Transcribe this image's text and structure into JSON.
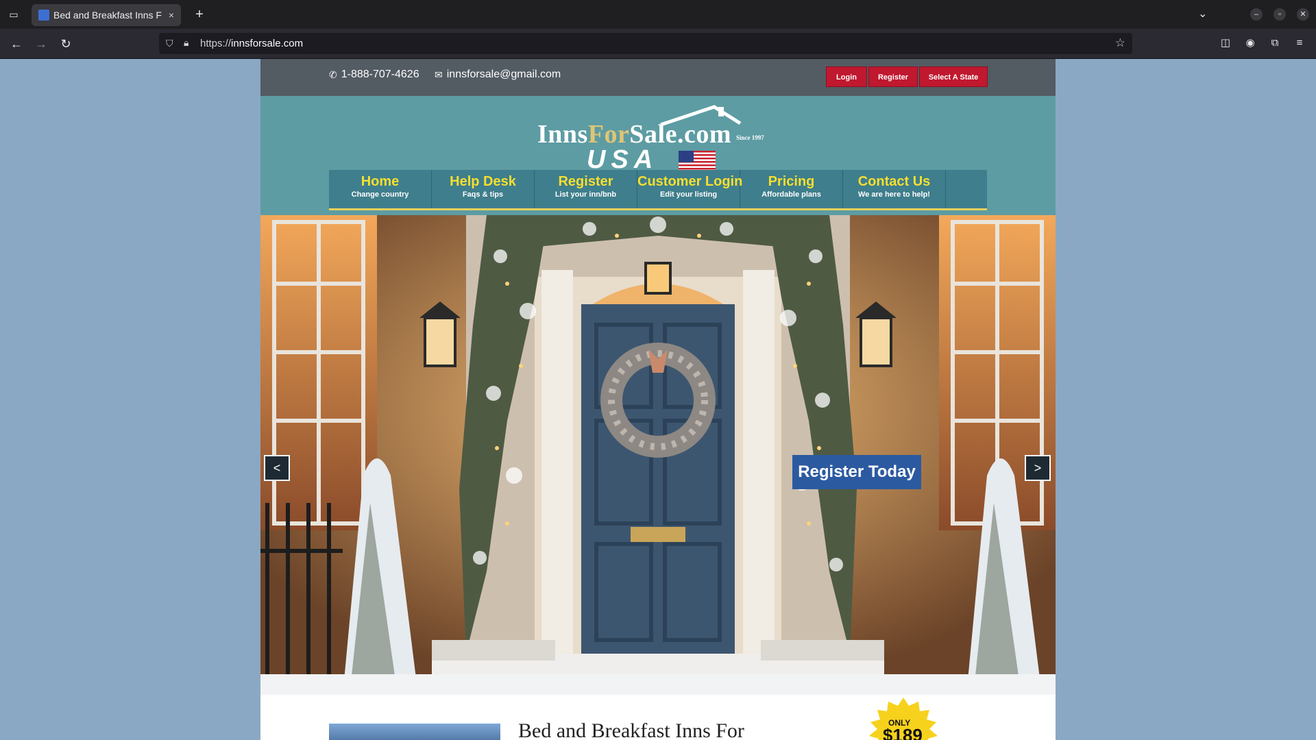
{
  "browser": {
    "tab_title": "Bed and Breakfast Inns F",
    "tab_close": "×",
    "new_tab": "+",
    "url_prefix": "https://",
    "url_host": "innsforsale.com"
  },
  "topbar": {
    "phone": "1-888-707-4626",
    "email": "innsforsale@gmail.com",
    "login": "Login",
    "register": "Register",
    "select_state": "Select A State"
  },
  "logo": {
    "inns": "Inns",
    "for": "For",
    "sale": "Sale",
    "com": ".com",
    "since": "Since 1997",
    "usa": "USA"
  },
  "nav": [
    {
      "label": "Home",
      "sub": "Change country"
    },
    {
      "label": "Help Desk",
      "sub": "Faqs & tips"
    },
    {
      "label": "Register",
      "sub": "List your inn/bnb"
    },
    {
      "label": "Customer Login",
      "sub": "Edit your listing"
    },
    {
      "label": "Pricing",
      "sub": "Affordable plans"
    },
    {
      "label": "Contact Us",
      "sub": "We are here to help!"
    }
  ],
  "hero": {
    "prev": "<",
    "next": ">",
    "cta": "Register Today"
  },
  "intro": {
    "title": "Bed and Breakfast Inns For",
    "badge_only": "ONLY",
    "badge_price": "$189"
  },
  "colors": {
    "topbar": "#535b63",
    "header": "#5d9ca3",
    "nav": "#3f7e8c",
    "nav_label": "#f6df2f",
    "button_red": "#c0182f",
    "cta_blue": "#2c5aa0",
    "page_bg": "#8aa8c3"
  }
}
